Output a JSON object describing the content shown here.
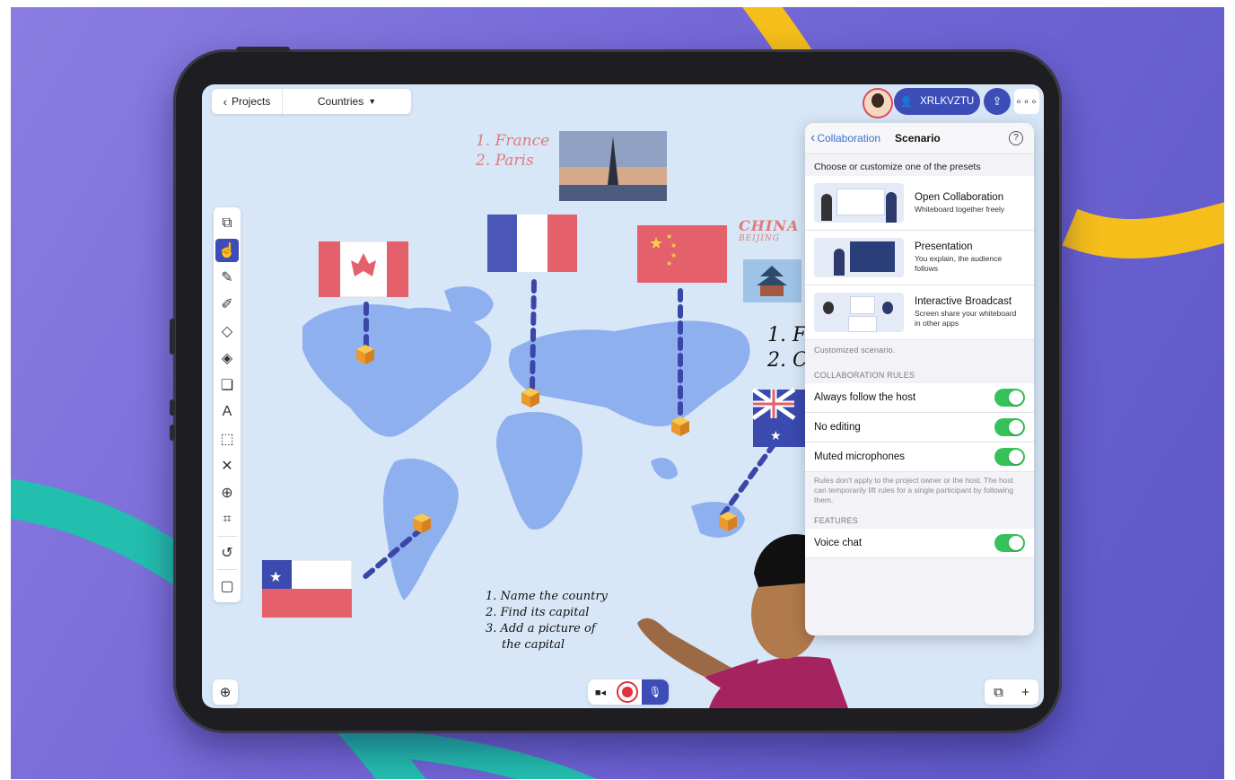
{
  "app": {
    "top_left": {
      "back_label": "Projects",
      "dropdown_label": "Countries"
    },
    "top_right": {
      "room_code": "XRLKVZTU"
    }
  },
  "canvas": {
    "note_france": [
      "1. France",
      "2. Paris"
    ],
    "note_china": [
      "CHINA",
      "BEIJING"
    ],
    "note_partial": [
      "1. F",
      "2. C"
    ],
    "task_list": [
      "1. Name the country",
      "2. Find its capital",
      "3. Add a picture of",
      "the capital"
    ]
  },
  "panel": {
    "back_label": "Collaboration",
    "title": "Scenario",
    "presets_header": "Choose or customize one of the presets",
    "presets": [
      {
        "title": "Open Collaboration",
        "subtitle": "Whiteboard together freely"
      },
      {
        "title": "Presentation",
        "subtitle": "You explain, the audience follows"
      },
      {
        "title": "Interactive Broadcast",
        "subtitle": "Screen share your whiteboard in other apps"
      }
    ],
    "customized_note": "Customized scenario.",
    "rules_header": "COLLABORATION RULES",
    "rules": [
      {
        "label": "Always follow the host",
        "on": true
      },
      {
        "label": "No editing",
        "on": true
      },
      {
        "label": "Muted microphones",
        "on": true
      }
    ],
    "rules_note": "Rules don't apply to the project owner or the host. The host can temporarily lift rules for a single participant by following them.",
    "features_header": "FEATURES",
    "features": [
      {
        "label": "Voice chat",
        "on": true
      }
    ]
  },
  "colors": {
    "accent": "#3c4db8",
    "toggle_on": "#36c25b",
    "link": "#3b6fd6"
  }
}
